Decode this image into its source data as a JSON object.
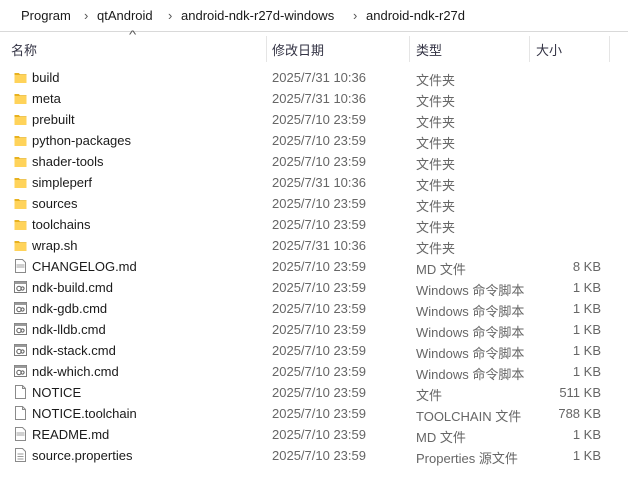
{
  "breadcrumb": {
    "lead": "›",
    "items": [
      "Program",
      "qtAndroid",
      "android-ndk-r27d-windows",
      "android-ndk-r27d"
    ],
    "separator": "›"
  },
  "columns": {
    "name": "名称",
    "date": "修改日期",
    "type": "类型",
    "size": "大小",
    "sort_indicator": "^"
  },
  "files": [
    {
      "name": "build",
      "date": "2025/7/31 10:36",
      "type": "文件夹",
      "size": "",
      "icon": "folder"
    },
    {
      "name": "meta",
      "date": "2025/7/31 10:36",
      "type": "文件夹",
      "size": "",
      "icon": "folder"
    },
    {
      "name": "prebuilt",
      "date": "2025/7/10 23:59",
      "type": "文件夹",
      "size": "",
      "icon": "folder"
    },
    {
      "name": "python-packages",
      "date": "2025/7/10 23:59",
      "type": "文件夹",
      "size": "",
      "icon": "folder"
    },
    {
      "name": "shader-tools",
      "date": "2025/7/10 23:59",
      "type": "文件夹",
      "size": "",
      "icon": "folder"
    },
    {
      "name": "simpleperf",
      "date": "2025/7/31 10:36",
      "type": "文件夹",
      "size": "",
      "icon": "folder"
    },
    {
      "name": "sources",
      "date": "2025/7/10 23:59",
      "type": "文件夹",
      "size": "",
      "icon": "folder"
    },
    {
      "name": "toolchains",
      "date": "2025/7/10 23:59",
      "type": "文件夹",
      "size": "",
      "icon": "folder"
    },
    {
      "name": "wrap.sh",
      "date": "2025/7/31 10:36",
      "type": "文件夹",
      "size": "",
      "icon": "folder"
    },
    {
      "name": "CHANGELOG.md",
      "date": "2025/7/10 23:59",
      "type": "MD 文件",
      "size": "8 KB",
      "icon": "md-file"
    },
    {
      "name": "ndk-build.cmd",
      "date": "2025/7/10 23:59",
      "type": "Windows 命令脚本",
      "size": "1 KB",
      "icon": "cmd-file"
    },
    {
      "name": "ndk-gdb.cmd",
      "date": "2025/7/10 23:59",
      "type": "Windows 命令脚本",
      "size": "1 KB",
      "icon": "cmd-file"
    },
    {
      "name": "ndk-lldb.cmd",
      "date": "2025/7/10 23:59",
      "type": "Windows 命令脚本",
      "size": "1 KB",
      "icon": "cmd-file"
    },
    {
      "name": "ndk-stack.cmd",
      "date": "2025/7/10 23:59",
      "type": "Windows 命令脚本",
      "size": "1 KB",
      "icon": "cmd-file"
    },
    {
      "name": "ndk-which.cmd",
      "date": "2025/7/10 23:59",
      "type": "Windows 命令脚本",
      "size": "1 KB",
      "icon": "cmd-file"
    },
    {
      "name": "NOTICE",
      "date": "2025/7/10 23:59",
      "type": "文件",
      "size": "511 KB",
      "icon": "blank-file"
    },
    {
      "name": "NOTICE.toolchain",
      "date": "2025/7/10 23:59",
      "type": "TOOLCHAIN 文件",
      "size": "788 KB",
      "icon": "blank-file"
    },
    {
      "name": "README.md",
      "date": "2025/7/10 23:59",
      "type": "MD 文件",
      "size": "1 KB",
      "icon": "md-file"
    },
    {
      "name": "source.properties",
      "date": "2025/7/10 23:59",
      "type": "Properties 源文件",
      "size": "1 KB",
      "icon": "properties-file"
    }
  ]
}
